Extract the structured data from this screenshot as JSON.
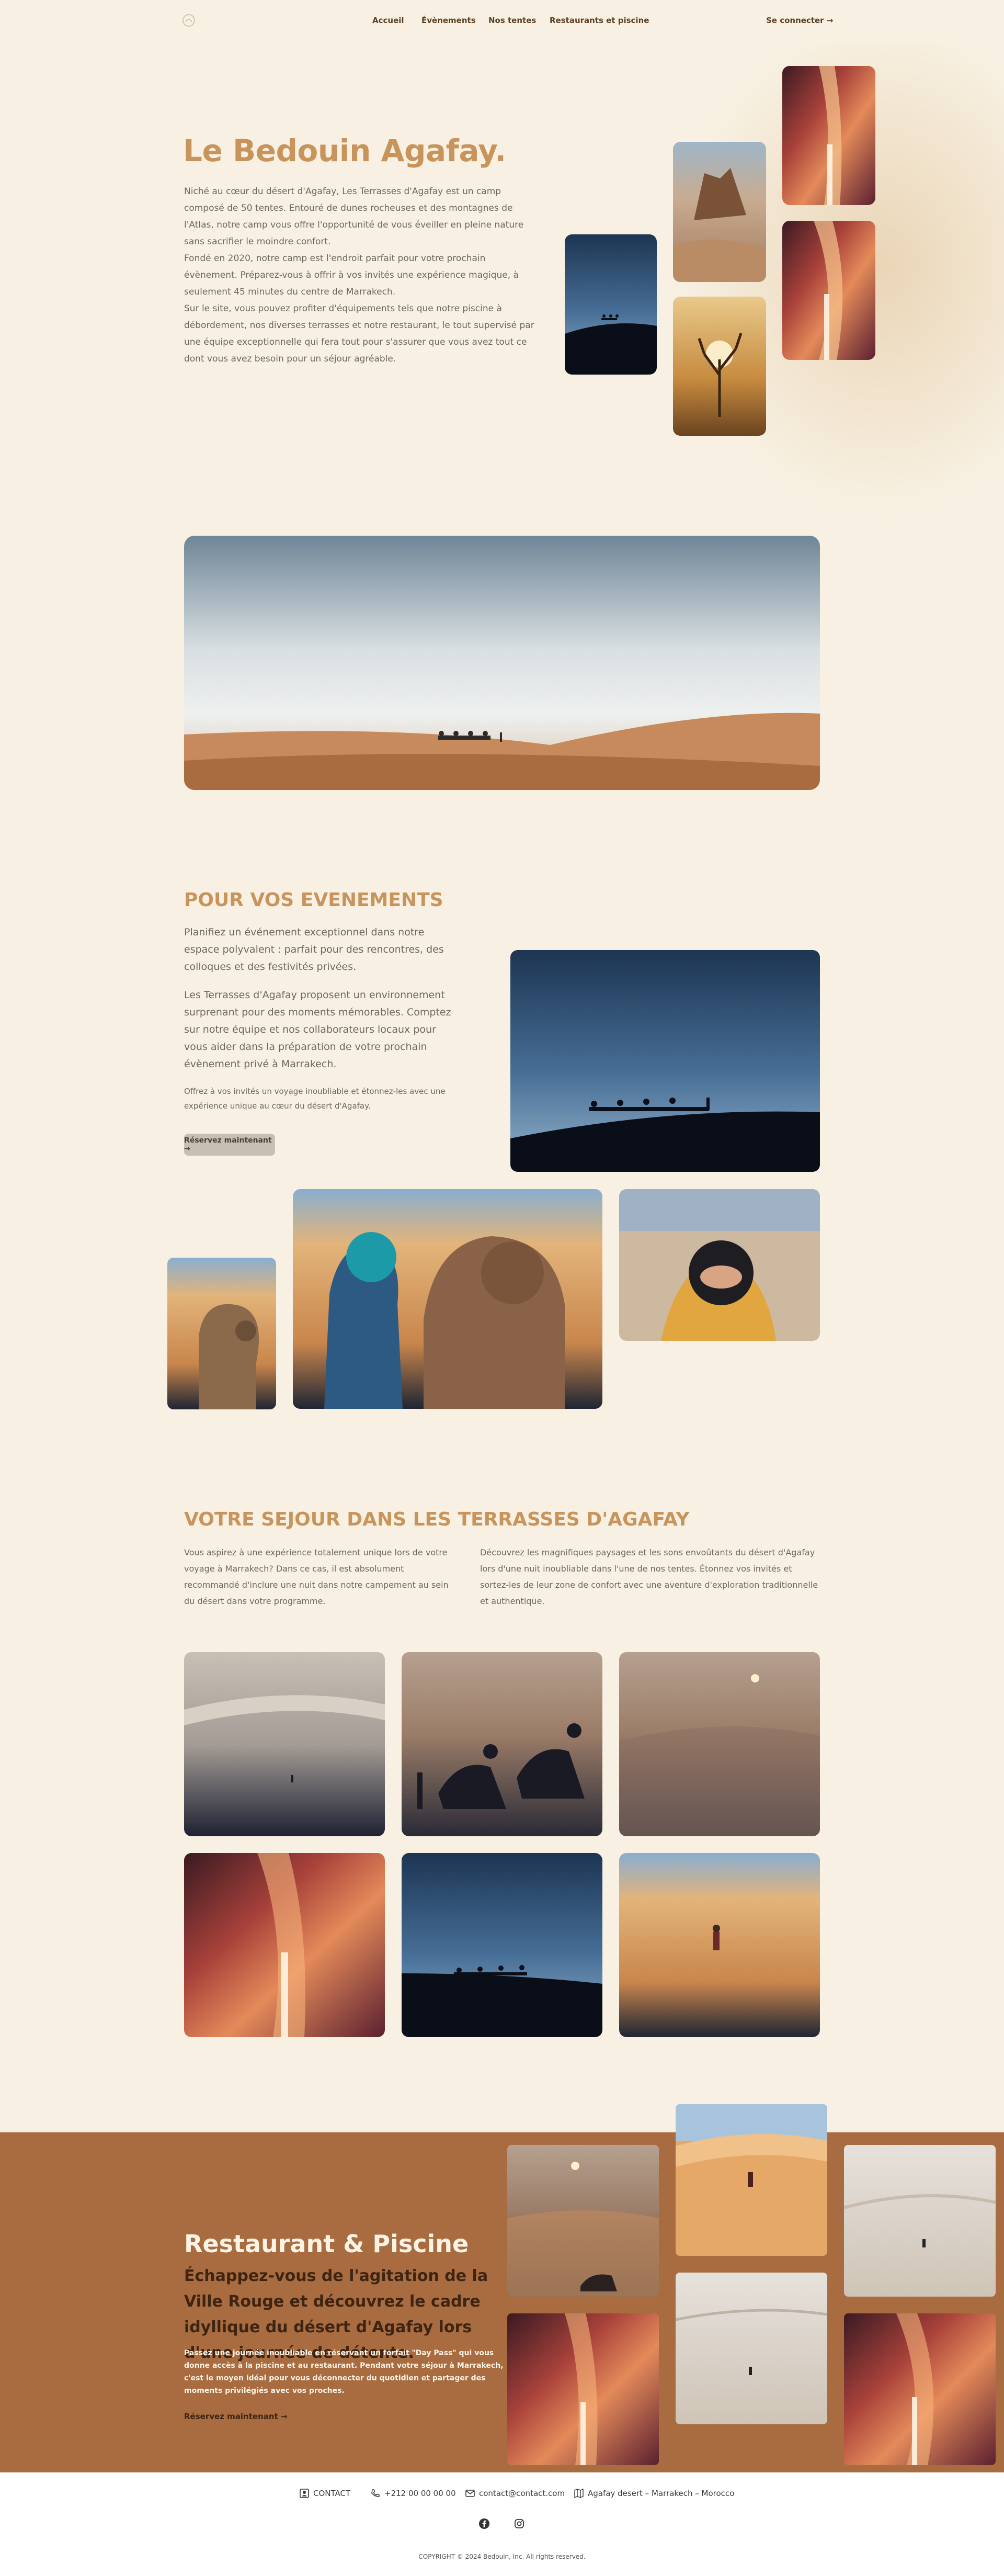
{
  "nav": {
    "links": [
      "Accueil",
      "Évènements",
      "Nos tentes",
      "Restaurants et piscine"
    ],
    "login_label": "Se connecter →"
  },
  "hero": {
    "title": "Le Bedouin Agafay.",
    "paragraphs": [
      "Niché au cœur du désert d'Agafay, Les Terrasses d'Agafay est un camp composé de 50 tentes. Entouré de dunes rocheuses et des montagnes de l'Atlas, notre camp vous offre l'opportunité de vous éveiller en pleine nature sans sacrifier le moindre confort.",
      "Fondé en 2020, notre camp est l'endroit parfait pour votre prochain évènement. Préparez-vous à offrir à vos invités une expérience magique, à seulement 45 minutes du centre de Marrakech.",
      "Sur le site, vous pouvez profiter d'équipements tels que notre piscine à débordement, nos diverses terrasses et notre restaurant, le tout supervisé par une équipe exceptionnelle qui fera tout pour s'assurer que vous avez tout ce dont vous avez besoin pour un séjour agréable."
    ]
  },
  "events": {
    "title": "POUR VOS EVENEMENTS",
    "p1": "Planifiez un événement exceptionnel dans notre espace polyvalent : parfait pour des rencontres, des colloques et des festivités privées.",
    "p2": "Les Terrasses d'Agafay proposent un environnement surprenant pour des moments mémorables. Comptez sur notre équipe et nos collaborateurs locaux pour vous aider dans la préparation de votre prochain évènement privé à Marrakech.",
    "p3": "Offrez à vos invités un voyage inoubliable et étonnez-les avec une expérience unique au cœur du désert d'Agafay.",
    "button": "Réservez maintenant →"
  },
  "sejour": {
    "title": "VOTRE SEJOUR DANS LES TERRASSES D'AGAFAY",
    "col1": "Vous aspirez à une expérience totalement unique lors de votre voyage à Marrakech? Dans ce cas, il est absolument recommandé d'inclure une nuit dans notre campement au sein du désert dans votre programme.",
    "col2": "Découvrez les magnifiques paysages et les sons envoûtants du désert d'Agafay lors d'une nuit inoubliable dans l'une de nos tentes. Étonnez vos invités et sortez-les de leur zone de confort avec une aventure d'exploration traditionnelle et authentique."
  },
  "restaurant": {
    "title": "Restaurant & Piscine",
    "subtitle": "Échappez-vous de l'agitation de la Ville Rouge et découvrez le cadre idyllique du désert d'Agafay lors d'une journée de détente.",
    "text": "Passez une journée inoubliable en réservant un forfait \"Day Pass\" qui vous donne accès à la piscine et au restaurant. Pendant votre séjour à Marrakech, c'est le moyen idéal pour vous déconnecter du quotidien et partager des moments privilégiés avec vos proches.",
    "link": "Réservez maintenant →"
  },
  "footer": {
    "contact": "CONTACT",
    "phone": "+212 00 00 00 00",
    "email": "contact@contact.com",
    "address": "Agafay desert – Marrakech – Morocco",
    "copyright": "COPYRIGHT © 2024 Bedouin, Inc. All rights reserved."
  },
  "colors": {
    "background": "#f8f1e3",
    "accent": "#c8945c",
    "band": "#a86c40",
    "dark_text": "#3e2412"
  },
  "icons": [
    "logo-icon",
    "contact-card-icon",
    "phone-icon",
    "mail-icon",
    "map-icon",
    "facebook-icon",
    "instagram-icon"
  ]
}
